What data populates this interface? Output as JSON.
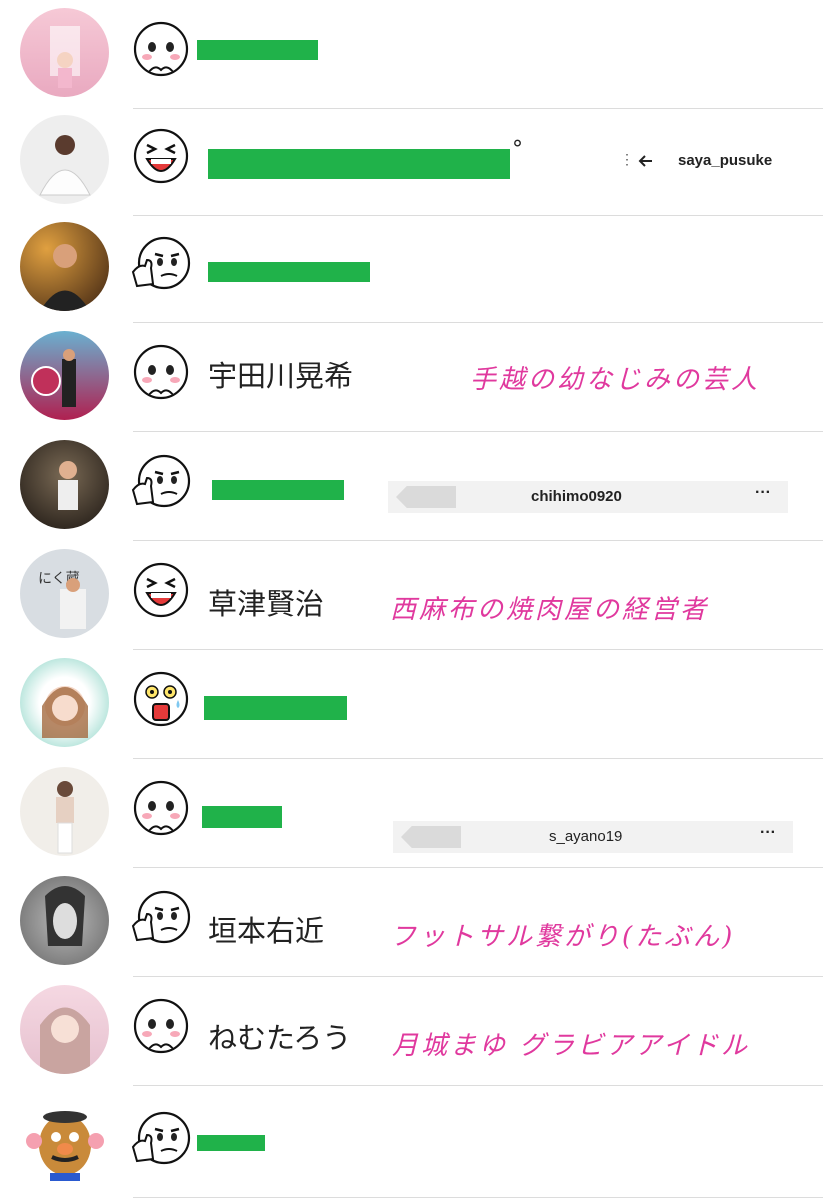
{
  "contacts": [
    {
      "name": "",
      "sticker": "face-icon-shy"
    },
    {
      "name": "",
      "sticker": "face-icon-laugh"
    },
    {
      "name": "",
      "sticker": "face-icon-thumbs-up"
    },
    {
      "name": "宇田川晃希",
      "sticker": "face-icon-shy",
      "note": "手越の幼なじみの芸人"
    },
    {
      "name": "",
      "sticker": "face-icon-thumbs-up",
      "ig_username": "chihimo0920"
    },
    {
      "name": "草津賢治",
      "sticker": "face-icon-laugh",
      "note": "西麻布の焼肉屋の経営者"
    },
    {
      "name": "",
      "sticker": "face-icon-shocked"
    },
    {
      "name": "",
      "sticker": "face-icon-shy",
      "ig_username": "s_ayano19"
    },
    {
      "name": "垣本右近",
      "sticker": "face-icon-thumbs-up",
      "note": "フットサル繋がり(たぶん)"
    },
    {
      "name": "ねむたろう",
      "sticker": "face-icon-shy",
      "note": "月城まゆ グラビアアイドル"
    },
    {
      "name": "",
      "sticker": "face-icon-thumbs-up"
    }
  ],
  "ig_header_1": {
    "username": "saya_pusuke",
    "back_icon": "arrow-left-icon"
  },
  "ig_header_more": "···",
  "colors": {
    "redaction": "#20b24a",
    "note": "#e0399e",
    "divider": "#dcdcdc"
  }
}
